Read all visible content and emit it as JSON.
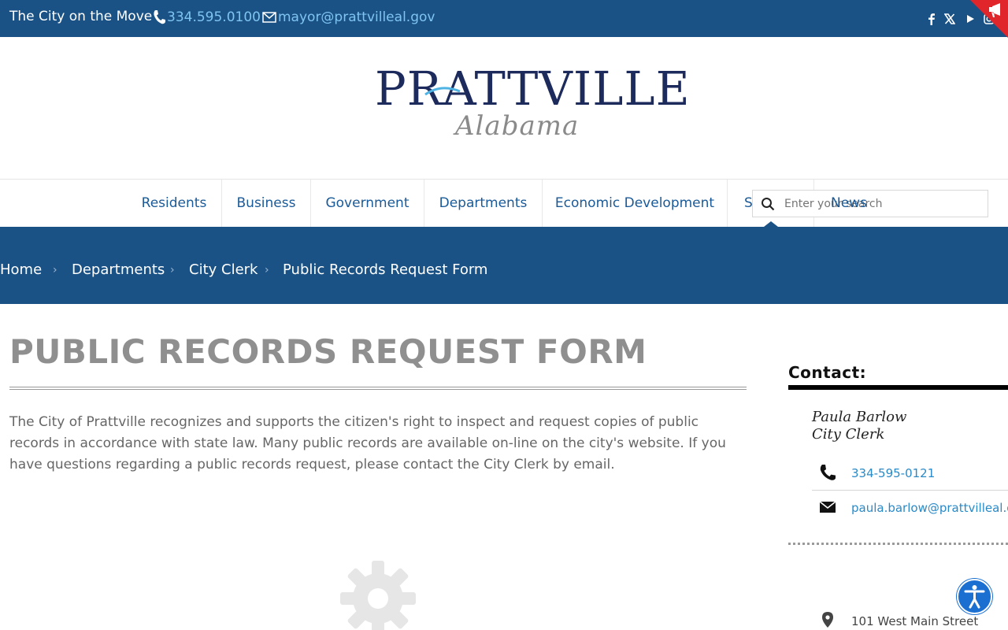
{
  "topbar": {
    "tagline": "The City on the Move",
    "phone": "334.595.0100",
    "email": "mayor@prattvilleal.gov",
    "social_icons": [
      "facebook-icon",
      "x-icon",
      "youtube-icon",
      "instagram-icon"
    ]
  },
  "logo": {
    "wordmark": "PRATTVILLE",
    "state": "Alabama"
  },
  "nav": {
    "items": [
      "Residents",
      "Business",
      "Government",
      "Departments",
      "Economic Development",
      "S",
      "News"
    ]
  },
  "search": {
    "placeholder": "Enter your search"
  },
  "breadcrumb": [
    "Home",
    "Departments",
    "City Clerk",
    "Public Records Request Form"
  ],
  "main": {
    "title": "PUBLIC RECORDS REQUEST FORM",
    "intro": "The City of Prattville recognizes and supports the citizen's right to inspect and request copies of public records in accordance with state law. Many public records are available on-line on the city's website. If you have questions regarding a public records request, please contact the City Clerk by email."
  },
  "sidebar": {
    "heading": "Contact:",
    "name": "Paula Barlow",
    "role": "City Clerk",
    "phone": "334-595-0121",
    "email": "paula.barlow@prattvilleal.gov",
    "address": "101 West Main Street"
  },
  "colors": {
    "brand_blue": "#1a5286",
    "link_blue": "#1a5a99",
    "accent_red": "#e0252b"
  }
}
